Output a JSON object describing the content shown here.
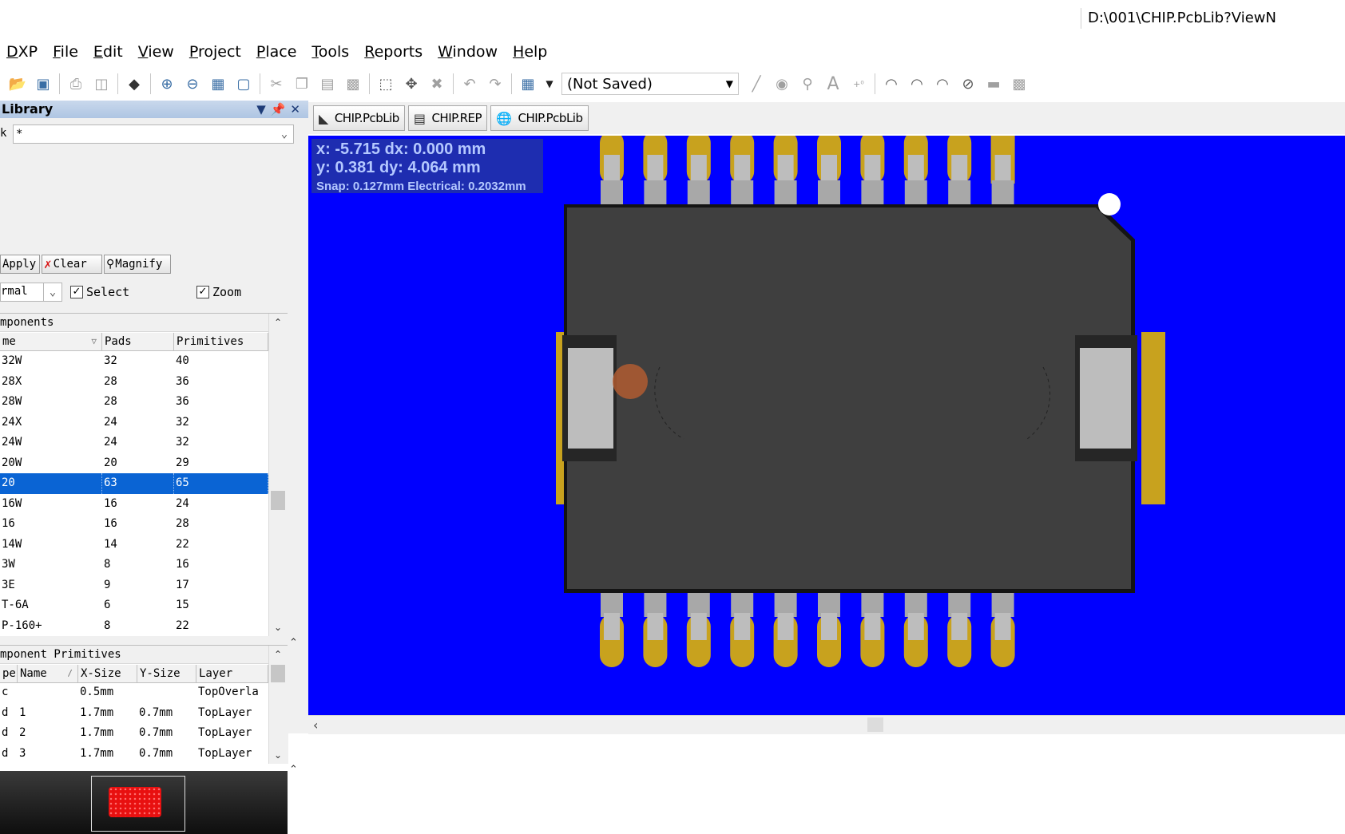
{
  "window": {
    "title": "D:\\001\\CHIP.PcbLib?ViewN"
  },
  "menu": [
    "DXP",
    "File",
    "Edit",
    "View",
    "Project",
    "Place",
    "Tools",
    "Reports",
    "Window",
    "Help"
  ],
  "toolbar": {
    "view_config": "(Not Saved)",
    "icons": [
      "open-icon",
      "save-icon",
      "print-icon",
      "print-preview-icon",
      "layer-stack-icon",
      "zoom-in-icon",
      "zoom-out-icon",
      "zoom-fit-icon",
      "zoom-area-icon",
      "cut-icon",
      "copy-icon",
      "paste-icon",
      "rubber-stamp-icon",
      "select-area-icon",
      "move-icon",
      "deselect-icon",
      "undo-icon",
      "redo-icon",
      "grid-icon",
      "line-icon",
      "pad-icon",
      "via-icon",
      "text-icon",
      "coordinate-icon",
      "arc-center-icon",
      "arc-edge-icon",
      "arc-any-icon",
      "circle-icon",
      "fill-icon",
      "array-paste-icon"
    ]
  },
  "library_panel": {
    "title": "Library",
    "mask_label": "k",
    "mask_value": "*",
    "apply_label": "Apply",
    "clear_label": "Clear",
    "magnify_label": "Magnify",
    "mode_value": "rmal",
    "select_label": "Select",
    "select_checked": true,
    "zoom_label": "Zoom",
    "zoom_checked": true,
    "components": {
      "title": "mponents",
      "headers": [
        "me",
        "Pads",
        "Primitives"
      ],
      "rows": [
        [
          "32W",
          "32",
          "40"
        ],
        [
          "28X",
          "28",
          "36"
        ],
        [
          "28W",
          "28",
          "36"
        ],
        [
          "24X",
          "24",
          "32"
        ],
        [
          "24W",
          "24",
          "32"
        ],
        [
          "20W",
          "20",
          "29"
        ],
        [
          "20",
          "63",
          "65"
        ],
        [
          "16W",
          "16",
          "24"
        ],
        [
          "16",
          "16",
          "28"
        ],
        [
          "14W",
          "14",
          "22"
        ],
        [
          "3W",
          "8",
          "16"
        ],
        [
          "3E",
          "9",
          "17"
        ],
        [
          "T-6A",
          "6",
          "15"
        ],
        [
          "P-160+",
          "8",
          "22"
        ]
      ],
      "selected_index": 6
    },
    "primitives": {
      "title": "mponent Primitives",
      "headers": [
        "pe",
        "Name",
        "X-Size",
        "Y-Size",
        "Layer"
      ],
      "rows": [
        [
          "c",
          "",
          "0.5mm",
          "",
          "TopOverla"
        ],
        [
          "d",
          "1",
          "1.7mm",
          "0.7mm",
          "TopLayer"
        ],
        [
          "d",
          "2",
          "1.7mm",
          "0.7mm",
          "TopLayer"
        ],
        [
          "d",
          "3",
          "1.7mm",
          "0.7mm",
          "TopLayer"
        ]
      ]
    }
  },
  "doc_tabs": [
    {
      "label": "CHIP.PcbLib",
      "icon": "pcblib-icon"
    },
    {
      "label": "CHIP.REP",
      "icon": "report-doc-icon"
    },
    {
      "label": "CHIP.PcbLib",
      "icon": "browser-doc-icon"
    }
  ],
  "coords": {
    "x_line": "x: -5.715   dx:  0.000 mm",
    "y_line": "y:  0.381   dy:  4.064 mm",
    "snap_line": "Snap: 0.127mm Electrical: 0.2032mm"
  },
  "colors": {
    "canvas": "#0000ff",
    "body": "#3d3d3d",
    "pad": "#c8a21e",
    "pin": "#bdbdbd",
    "selection": "#0a64d4"
  }
}
